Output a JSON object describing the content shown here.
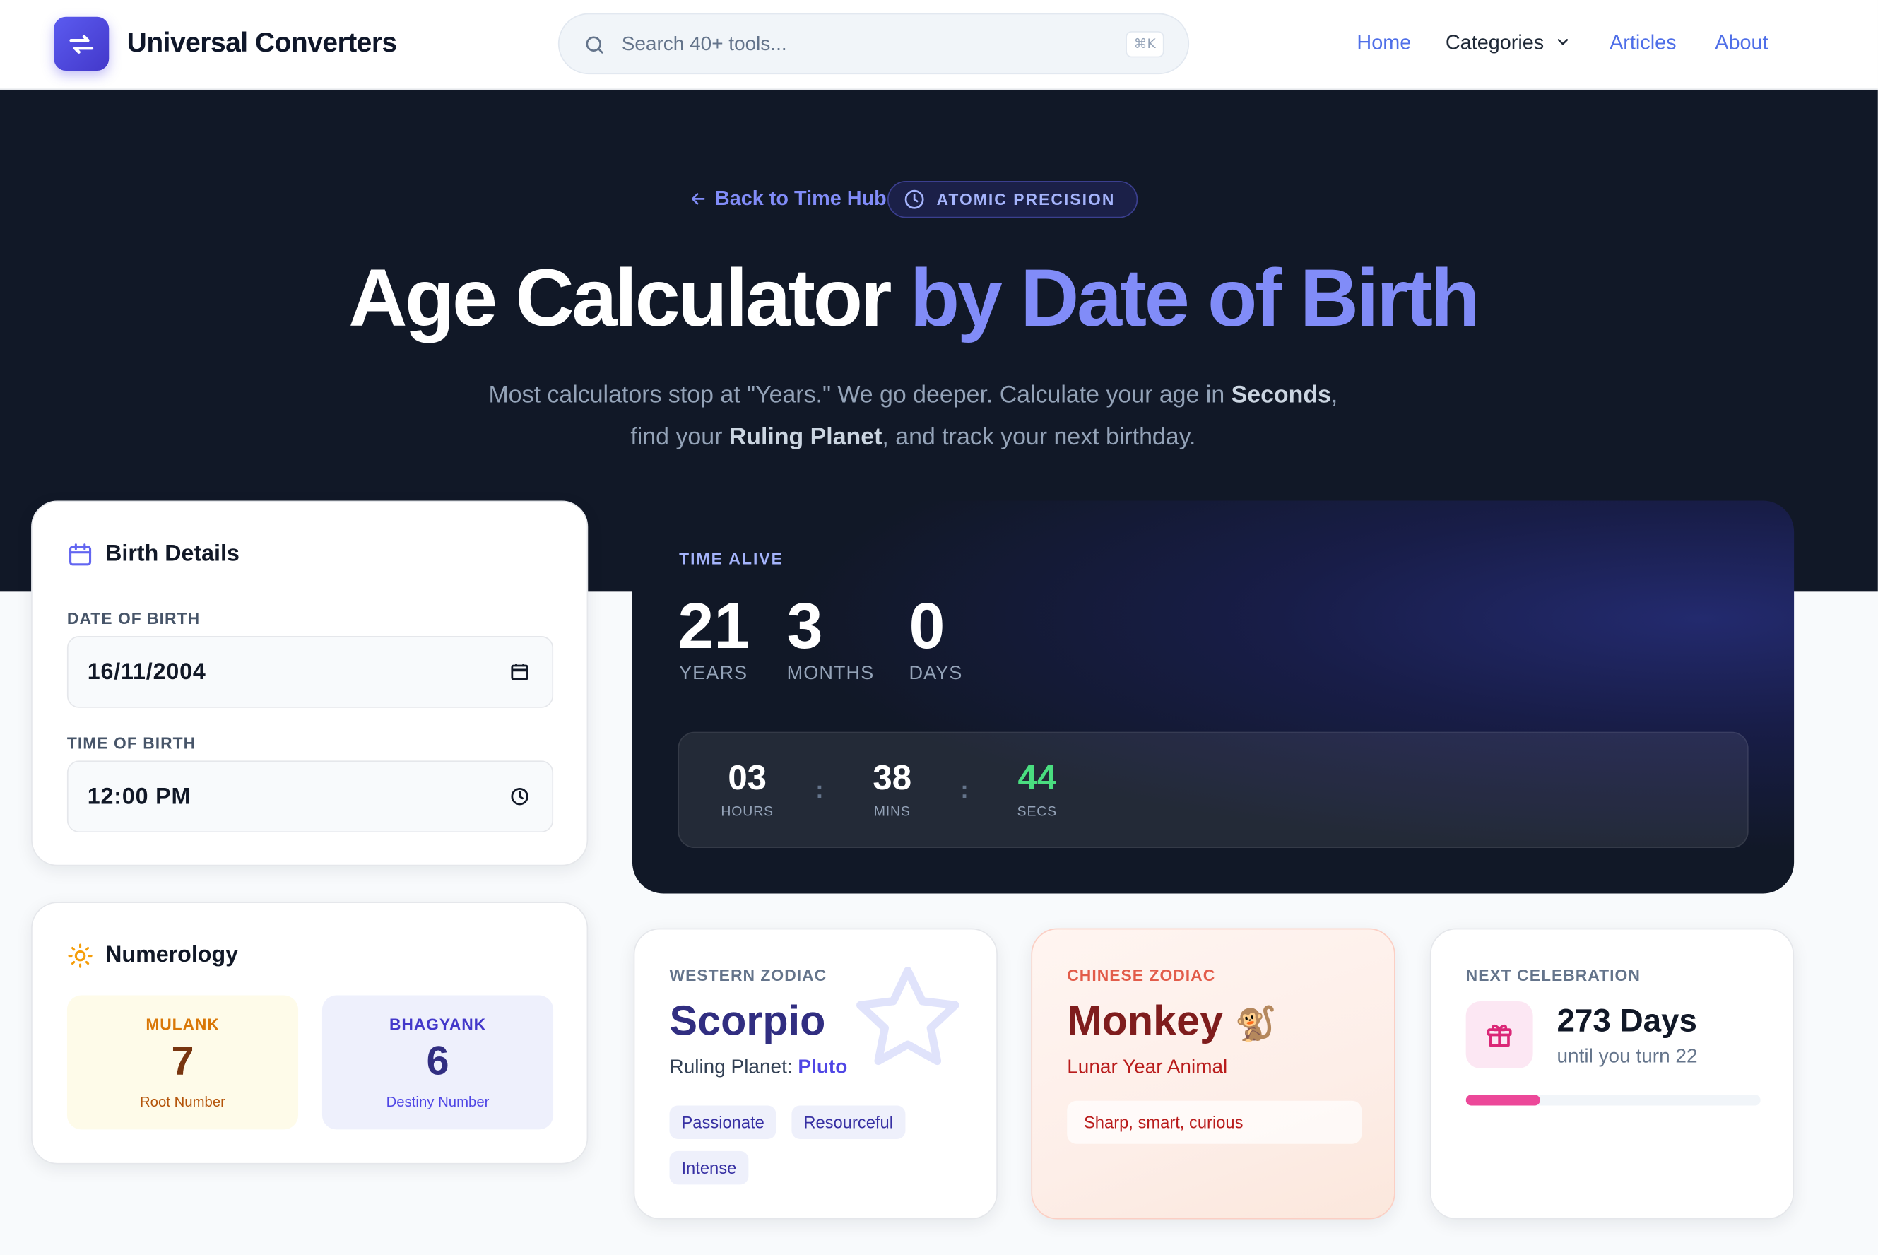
{
  "header": {
    "brand": "Universal Converters",
    "search_placeholder": "Search 40+ tools...",
    "search_shortcut": "⌘K",
    "nav": {
      "home": "Home",
      "categories": "Categories",
      "articles": "Articles",
      "about": "About"
    }
  },
  "hero": {
    "back_link": "Back to Time Hub",
    "badge": "ATOMIC PRECISION",
    "title_main": "Age Calculator",
    "title_highlight": "by Date of Birth",
    "subtitle_1a": "Most calculators stop at \"Years.\" We go deeper. Calculate your age in ",
    "subtitle_1b": "Seconds",
    "subtitle_1c": ",",
    "subtitle_2a": "find your ",
    "subtitle_2b": "Ruling Planet",
    "subtitle_2c": ", and track your next birthday."
  },
  "birth_details": {
    "title": "Birth Details",
    "dob_label": "DATE OF BIRTH",
    "dob_value": "16/11/2004",
    "tob_label": "TIME OF BIRTH",
    "tob_value": "12:00 PM"
  },
  "numerology": {
    "title": "Numerology",
    "mulank": {
      "label": "MULANK",
      "value": "7",
      "caption": "Root Number"
    },
    "bhagyank": {
      "label": "BHAGYANK",
      "value": "6",
      "caption": "Destiny Number"
    }
  },
  "time_alive": {
    "label": "TIME ALIVE",
    "years": "21",
    "years_label": "YEARS",
    "months": "3",
    "months_label": "MONTHS",
    "days": "0",
    "days_label": "DAYS",
    "hours": "03",
    "hours_label": "HOURS",
    "mins": "38",
    "mins_label": "MINS",
    "secs": "44",
    "secs_label": "SECS",
    "separator": ":"
  },
  "western_zodiac": {
    "label": "WESTERN ZODIAC",
    "sign": "Scorpio",
    "planet_prefix": "Ruling Planet: ",
    "planet": "Pluto",
    "traits": [
      "Passionate",
      "Resourceful",
      "Intense"
    ]
  },
  "chinese_zodiac": {
    "label": "CHINESE ZODIAC",
    "animal": "Monkey",
    "emoji": "🐒",
    "caption": "Lunar Year Animal",
    "traits": "Sharp, smart, curious"
  },
  "celebration": {
    "label": "NEXT CELEBRATION",
    "days": "273 Days",
    "caption": "until you turn 22",
    "progress": 0.25
  },
  "colors": {
    "accent": "#4f46e5",
    "hero_bg": "#111827",
    "highlight": "#818cf8",
    "secs_green": "#4ade80",
    "celebration_pink": "#ec4899"
  }
}
